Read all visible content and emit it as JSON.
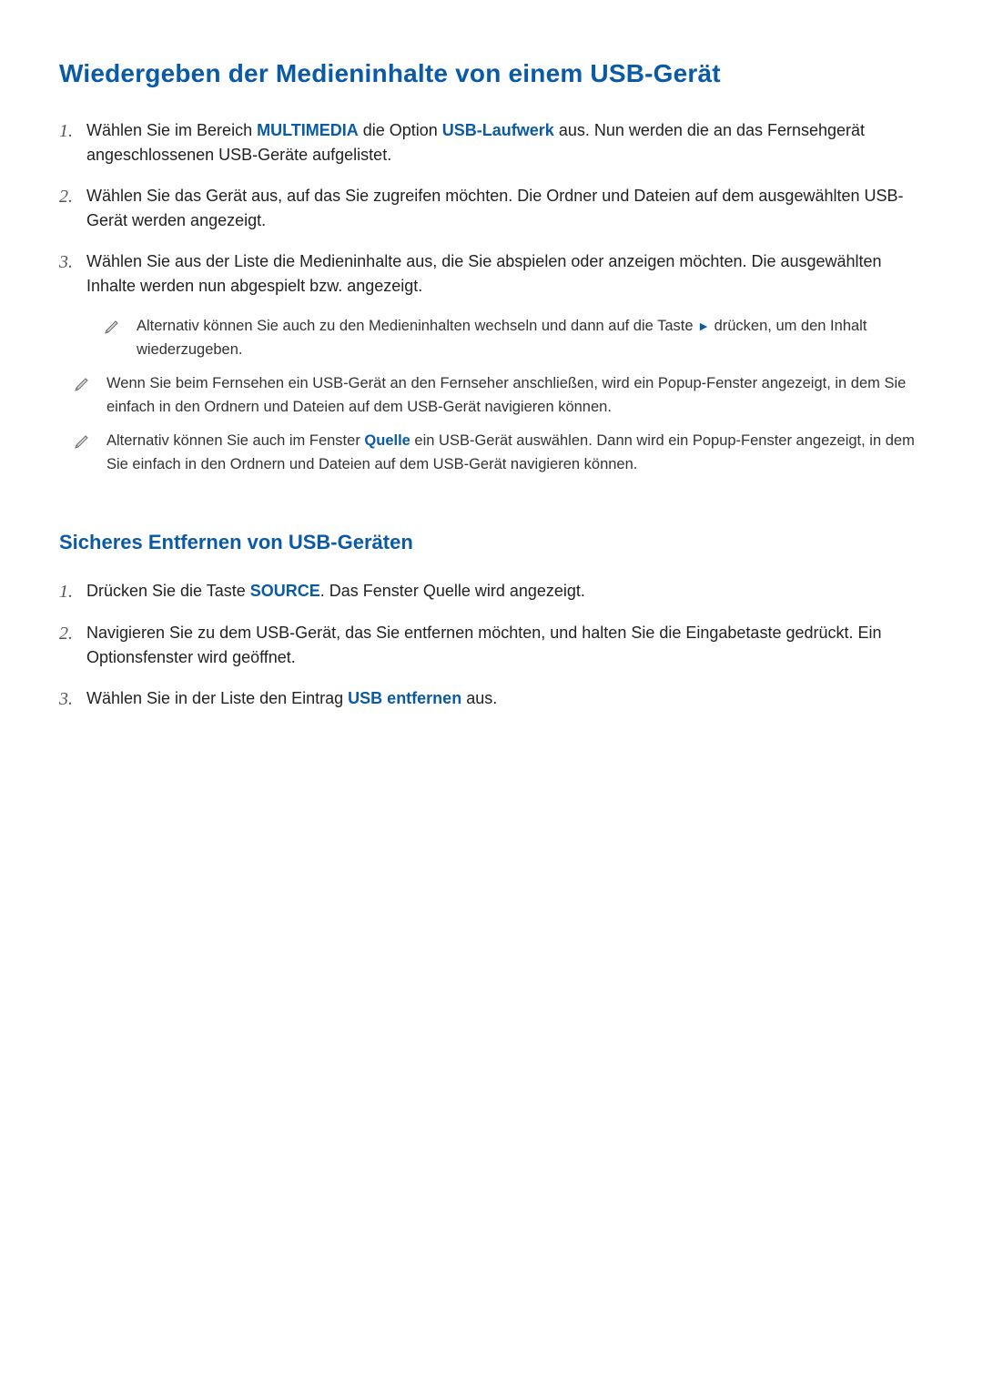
{
  "title": "Wiedergeben der Medieninhalte von einem USB-Gerät",
  "section1": {
    "steps": [
      {
        "n": "1.",
        "pre": "Wählen Sie im Bereich ",
        "kw1": "MULTIMEDIA",
        "mid": " die Option ",
        "kw2": "USB-Laufwerk",
        "post": " aus. Nun werden die an das Fernsehgerät angeschlossenen USB-Geräte aufgelistet."
      },
      {
        "n": "2.",
        "text": "Wählen Sie das Gerät aus, auf das Sie zugreifen möchten. Die Ordner und Dateien auf dem ausgewählten USB-Gerät werden angezeigt."
      },
      {
        "n": "3.",
        "text": "Wählen Sie aus der Liste die Medieninhalte aus, die Sie abspielen oder anzeigen möchten. Die ausgewählten Inhalte werden nun abgespielt bzw. angezeigt."
      }
    ],
    "subnote": {
      "pre": "Alternativ können Sie auch zu den Medieninhalten wechseln und dann auf die Taste ",
      "glyph": "►",
      "post": " drücken, um den Inhalt wiederzugeben."
    },
    "notes": [
      {
        "text": "Wenn Sie beim Fernsehen ein USB-Gerät an den Fernseher anschließen, wird ein Popup-Fenster angezeigt, in dem Sie einfach in den Ordnern und Dateien auf dem USB-Gerät navigieren können."
      },
      {
        "pre": "Alternativ können Sie auch im Fenster ",
        "kw": "Quelle",
        "post": " ein USB-Gerät auswählen. Dann wird ein Popup-Fenster angezeigt, in dem Sie einfach in den Ordnern und Dateien auf dem USB-Gerät navigieren können."
      }
    ]
  },
  "section2": {
    "title": "Sicheres Entfernen von USB-Geräten",
    "steps": [
      {
        "n": "1.",
        "pre": "Drücken Sie die Taste ",
        "kw": "SOURCE",
        "post": ". Das Fenster Quelle wird angezeigt."
      },
      {
        "n": "2.",
        "text": "Navigieren Sie zu dem USB-Gerät, das Sie entfernen möchten, und halten Sie die Eingabetaste gedrückt. Ein Optionsfenster wird geöffnet."
      },
      {
        "n": "3.",
        "pre": "Wählen Sie in der Liste den Eintrag ",
        "kw": "USB entfernen",
        "post": " aus."
      }
    ]
  }
}
